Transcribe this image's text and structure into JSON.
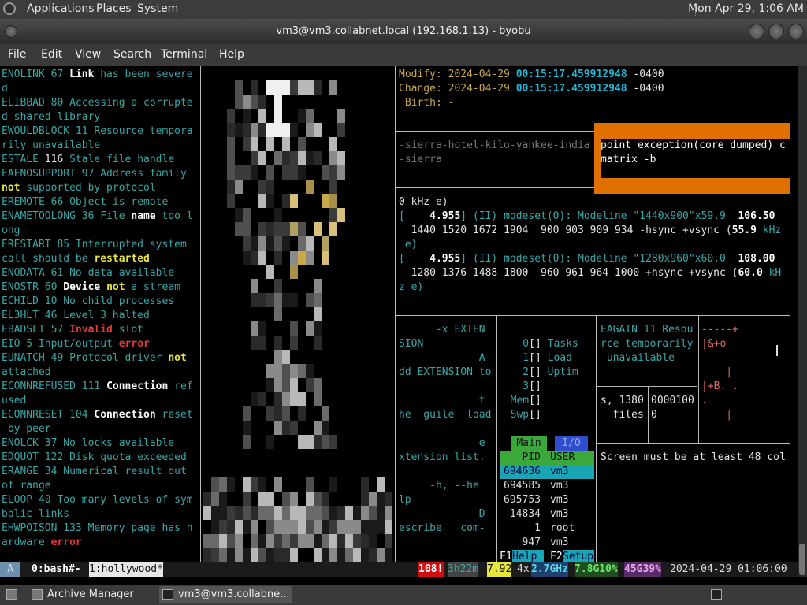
{
  "top_panel": {
    "menus": [
      "Applications",
      "Places",
      "System"
    ],
    "clock": "Mon Apr 29, 1:06 AM"
  },
  "window": {
    "title": "vm3@vm3.collabnet.local (192.168.1.13) - byobu"
  },
  "menubar": [
    "File",
    "Edit",
    "View",
    "Search",
    "Terminal",
    "Help"
  ],
  "errno_pane": [
    [
      [
        "ENOLINK 67 ",
        "cy"
      ],
      [
        "Link",
        "wb"
      ],
      [
        " has been severe",
        "cy"
      ]
    ],
    [
      [
        "d",
        "cy"
      ]
    ],
    [
      [
        "ELIBBAD 80 Accessing a corrupte",
        "cy"
      ]
    ],
    [
      [
        "d shared library",
        "cy"
      ]
    ],
    [
      [
        "EWOULDBLOCK 11 Resource tempora",
        "cy"
      ]
    ],
    [
      [
        "rily unavailable",
        "cy"
      ]
    ],
    [
      [
        "ESTALE ",
        "cy"
      ],
      [
        "116",
        "wh"
      ],
      [
        " Stale file handle",
        "cy"
      ]
    ],
    [
      [
        "EAFNOSUPPORT 97 Address family",
        "cy"
      ]
    ],
    [
      [
        "not",
        "ye"
      ],
      [
        " supported by protocol",
        "cy"
      ]
    ],
    [
      [
        "EREMOTE 66 Object is remote",
        "cy"
      ]
    ],
    [
      [
        "ENAMETOOLONG 36 File ",
        "cy"
      ],
      [
        "name",
        "wb"
      ],
      [
        " too l",
        "cy"
      ]
    ],
    [
      [
        "ong",
        "cy"
      ]
    ],
    [
      [
        "ERESTART 85 Interrupted system",
        "cy"
      ]
    ],
    [
      [
        "call should be ",
        "cy"
      ],
      [
        "restarted",
        "ye"
      ]
    ],
    [
      [
        "ENODATA 61 No data available",
        "cy"
      ]
    ],
    [
      [
        "ENOSTR 60 ",
        "cy"
      ],
      [
        "Device",
        "wb"
      ],
      [
        " ",
        "cy"
      ],
      [
        "not",
        "ye"
      ],
      [
        " a stream",
        "cy"
      ]
    ],
    [
      [
        "ECHILD 10 No child processes",
        "cy"
      ]
    ],
    [
      [
        "EL3HLT 46 Level 3 halted",
        "cy"
      ]
    ],
    [
      [
        "EBADSLT 57 ",
        "cy"
      ],
      [
        "Invalid",
        "rd"
      ],
      [
        " slot",
        "cy"
      ]
    ],
    [
      [
        "EIO 5 Input/output ",
        "cy"
      ],
      [
        "error",
        "rd"
      ]
    ],
    [
      [
        "EUNATCH 49 Protocol driver ",
        "cy"
      ],
      [
        "not",
        "ye"
      ]
    ],
    [
      [
        "attached",
        "cy"
      ]
    ],
    [
      [
        "ECONNREFUSED 111 ",
        "cy"
      ],
      [
        "Connection",
        "wb"
      ],
      [
        " ref",
        "cy"
      ]
    ],
    [
      [
        "used",
        "cy"
      ]
    ],
    [
      [
        "ECONNRESET 104 ",
        "cy"
      ],
      [
        "Connection",
        "wb"
      ],
      [
        " reset",
        "cy"
      ]
    ],
    [
      [
        " by peer",
        "cy"
      ]
    ],
    [
      [
        "ENOLCK 37 No locks available",
        "cy"
      ]
    ],
    [
      [
        "EDQUOT 122 Disk quota exceeded",
        "cy"
      ]
    ],
    [
      [
        "ERANGE 34 Numerical result out",
        "cy"
      ]
    ],
    [
      [
        "of range",
        "cy"
      ]
    ],
    [
      [
        "ELOOP 40 Too many levels of sym",
        "cy"
      ]
    ],
    [
      [
        "bolic links",
        "cy"
      ]
    ],
    [
      [
        "EHWPOISON 133 Memory page has h",
        "cy"
      ]
    ],
    [
      [
        "ardware ",
        "cy"
      ],
      [
        "error",
        "rd"
      ]
    ]
  ],
  "stat_pane": [
    [
      [
        "Modify: ",
        "tan"
      ],
      [
        "2024-04-29 ",
        "tan"
      ],
      [
        "00:15:17.459912948",
        "tb"
      ],
      [
        " -0400",
        "wh"
      ]
    ],
    [
      [
        "Change: ",
        "tan"
      ],
      [
        "2024-04-29 ",
        "tan"
      ],
      [
        "00:15:17.459912948",
        "tb"
      ],
      [
        " -0400",
        "wh"
      ]
    ],
    [
      [
        " Birth: -",
        "tan"
      ]
    ]
  ],
  "nato_pane": [
    "-sierra-hotel-kilo-yankee-india",
    "-sierra"
  ],
  "orange_box": [
    "point exception(core dumped) c",
    "matrix -b"
  ],
  "dmesg_pane": [
    [
      [
        "0 kHz e)",
        "wh"
      ]
    ],
    [
      [
        "[    ",
        "cy"
      ],
      [
        "4.955",
        "wb"
      ],
      [
        "] (II) modeset(0): Modeline \"1440x900\"x59.9  ",
        "cy"
      ],
      [
        "106.50",
        "wb"
      ]
    ],
    [
      [
        "  1440 1520 1672 1904  900 903 909 934 -hsync +vsync (",
        "wh"
      ],
      [
        "55.9",
        "wb"
      ],
      [
        " kHz",
        "cy"
      ]
    ],
    [
      [
        " e)",
        "cy"
      ]
    ],
    [
      [
        "[    ",
        "cy"
      ],
      [
        "4.955",
        "wb"
      ],
      [
        "] (II) modeset(0): Modeline \"1280x960\"x60.0  ",
        "cy"
      ],
      [
        "108.00",
        "wb"
      ]
    ],
    [
      [
        "  1280 1376 1488 1800  960 961 964 1000 +hsync +vsync (",
        "wh"
      ],
      [
        "60.0",
        "wb"
      ],
      [
        " kH",
        "cy"
      ]
    ],
    [
      [
        "z e)",
        "cy"
      ]
    ]
  ],
  "man_pane": [
    "      -x EXTEN",
    "SION",
    "             A",
    "dd EXTENSION to",
    "",
    "             t",
    "he  guile  load",
    "",
    "             e",
    "xtension list.",
    "",
    "     -h, --he",
    "lp",
    "             D",
    "escribe   com-"
  ],
  "meters": {
    "cpu": [
      "0",
      "1",
      "2",
      "3"
    ],
    "labels": [
      "Tasks",
      "Load",
      "Uptim"
    ],
    "mem": "Mem",
    "swp": "Swp"
  },
  "htop": {
    "tabs": [
      "Main",
      "I/O"
    ],
    "header": {
      "pid": "PID",
      "user": "USER"
    },
    "rows": [
      {
        "pid": "694636",
        "user": "vm3"
      },
      {
        "pid": "694585",
        "user": "vm3"
      },
      {
        "pid": "695753",
        "user": "vm3"
      },
      {
        "pid": "14834",
        "user": "vm3"
      },
      {
        "pid": "1",
        "user": "root"
      },
      {
        "pid": "947",
        "user": "vm3"
      }
    ],
    "fkeys": [
      {
        "key": "F1",
        "label": "Help"
      },
      {
        "key": "F2",
        "label": "Setup"
      }
    ]
  },
  "eagain_pane": [
    "EAGAIN 11 Resou",
    "rce temporarily",
    " unavailable"
  ],
  "files_pane": [
    "s, 1380",
    "  files"
  ],
  "hex_pane": [
    "0000100",
    "0"
  ],
  "red_art": [
    "-----+",
    "|&+o",
    "",
    "    |",
    "|+B. .",
    ".",
    "    |"
  ],
  "screen_msg": "Screen must be at least 48 col",
  "statusbar": {
    "session": "A",
    "win0": "0:bash#-",
    "win1": "1:hollywood*",
    "alert": "108!",
    "uptime": "3h22m",
    "load": "7.92",
    "cpu_count": "4x",
    "cpu_freq": "2.7GHz",
    "mem": "7.8G10%",
    "disk": "45G39%",
    "datetime": "2024-04-29 01:06:00"
  },
  "taskbar": [
    "Archive Manager",
    "vm3@vm3.collabne..."
  ],
  "colors": {
    "orange": "#e07000",
    "teal": "#3aa6a6",
    "green": "#3aa83a"
  }
}
